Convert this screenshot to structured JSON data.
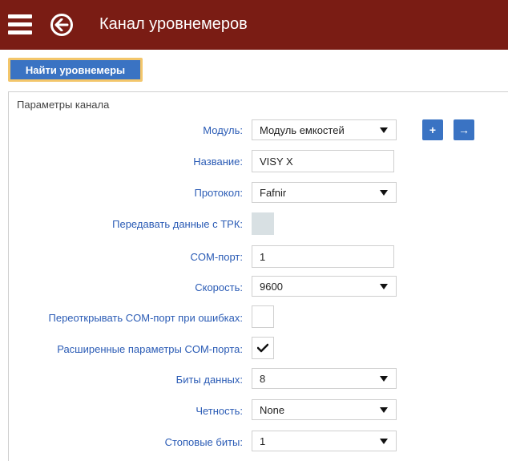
{
  "header": {
    "title": "Канал уровнемеров",
    "menu_icon": "hamburger-icon",
    "back_icon": "back-arrow-icon",
    "bg_color": "#7a1c14"
  },
  "toolbar": {
    "find_button": "Найти уровнемеры"
  },
  "panel": {
    "title": "Параметры канала",
    "add_button": "+",
    "next_button": "→",
    "fields": {
      "module": {
        "label": "Модуль:",
        "value": "Модуль емкостей"
      },
      "name": {
        "label": "Название:",
        "value": "VISY X"
      },
      "protocol": {
        "label": "Протокол:",
        "value": "Fafnir"
      },
      "pass_data": {
        "label": "Передавать данные с ТРК:",
        "checked": false,
        "disabled": true
      },
      "com_port": {
        "label": "COM-порт:",
        "value": "1"
      },
      "speed": {
        "label": "Скорость:",
        "value": "9600"
      },
      "reopen_com": {
        "label": "Переоткрывать COM-порт при ошибках:",
        "checked": false
      },
      "extended_com": {
        "label": "Расширенные параметры COM-порта:",
        "checked": true
      },
      "data_bits": {
        "label": "Биты данных:",
        "value": "8"
      },
      "parity": {
        "label": "Четность:",
        "value": "None"
      },
      "stop_bits": {
        "label": "Стоповые биты:",
        "value": "1"
      }
    }
  }
}
